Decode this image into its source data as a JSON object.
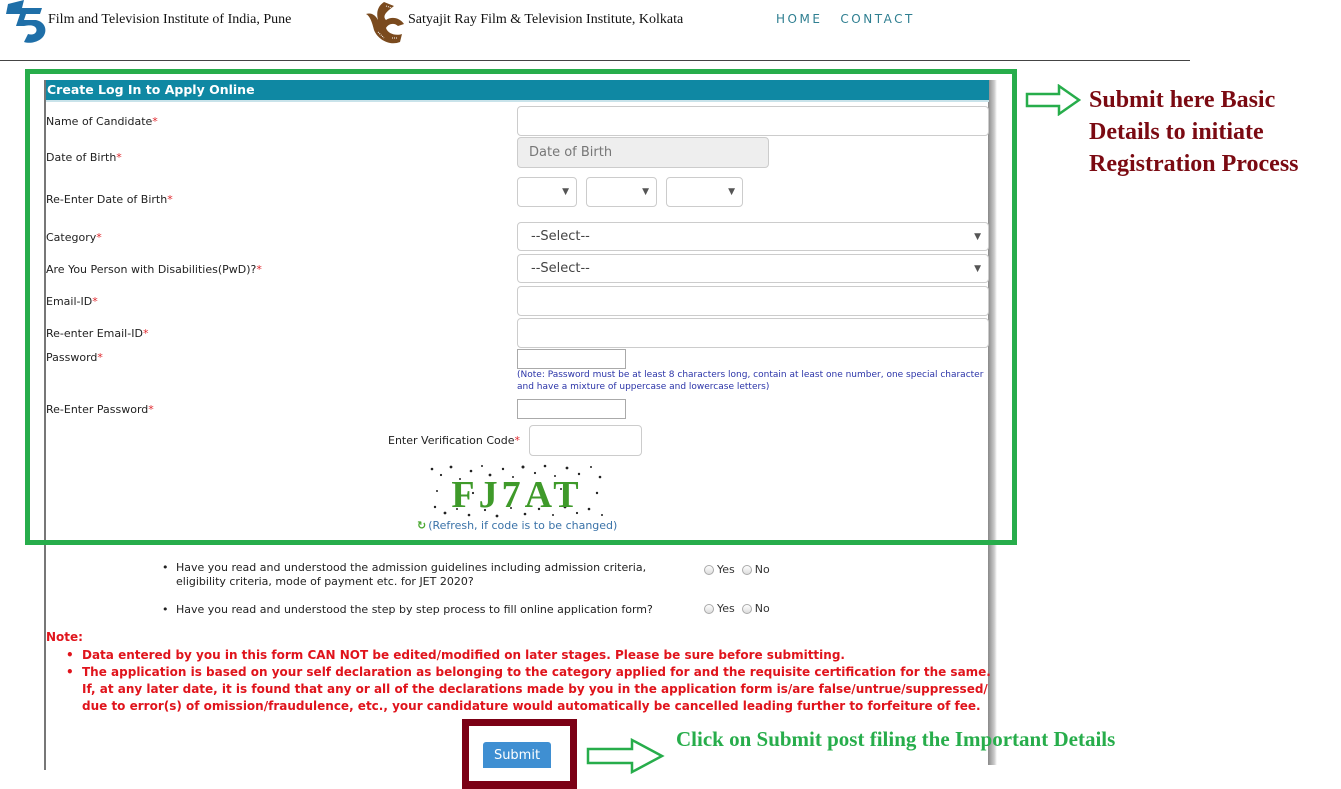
{
  "header": {
    "institute1": "Film and Television Institute of India, Pune",
    "institute2": "Satyajit Ray Film & Television Institute, Kolkata",
    "nav": [
      {
        "label": "HOME"
      },
      {
        "label": "CONTACT"
      }
    ]
  },
  "form": {
    "title": "Create Log In to Apply Online",
    "required_mark": "*",
    "fields": {
      "name": {
        "label": "Name of Candidate",
        "value": ""
      },
      "dob": {
        "label": "Date of Birth",
        "placeholder": "Date of Birth"
      },
      "dob_reenter": {
        "label": "Re-Enter Date of Birth",
        "day": "",
        "month": "",
        "year": ""
      },
      "category": {
        "label": "Category",
        "selected": "--Select--"
      },
      "pwd": {
        "label": "Are You Person with Disabilities(PwD)?",
        "selected": "--Select--"
      },
      "email": {
        "label": "Email-ID",
        "value": ""
      },
      "email_reenter": {
        "label": "Re-enter Email-ID",
        "value": ""
      },
      "password": {
        "label": "Password",
        "value": "",
        "note": "(Note: Password must be at least 8 characters long, contain at least one number, one special character and have a mixture of uppercase and lowercase letters)"
      },
      "password_reenter": {
        "label": "Re-Enter Password",
        "value": ""
      },
      "verification": {
        "label": "Enter Verification Code",
        "value": "",
        "captcha_text": "FJ7AT",
        "refresh_label": "(Refresh, if code is to be changed)"
      }
    },
    "questions": [
      {
        "text": "Have you read and understood the admission guidelines including admission criteria, eligibility criteria, mode of payment etc. for JET 2020?",
        "options": [
          "Yes",
          "No"
        ]
      },
      {
        "text": "Have you read and understood the step by step process to fill online application form?",
        "options": [
          "Yes",
          "No"
        ]
      }
    ],
    "note": {
      "title": "Note:",
      "items": [
        "Data entered by you in this form CAN NOT be edited/modified on later stages. Please be sure before submitting.",
        "The application is based on your self declaration as belonging to the category applied for and the requisite certification for the same. If, at any later date, it is found that any or all of the declarations made by you in the application form is/are false/untrue/suppressed/ due to error(s) of omission/fraudulence, etc., your candidature would automatically be cancelled leading further to forfeiture of fee."
      ]
    },
    "submit_label": "Submit"
  },
  "annotations": {
    "basic_details": "Submit here Basic Details to initiate Registration Process",
    "submit_hint": "Click on Submit post filing the Important Details",
    "colors": {
      "green": "#27ad4b",
      "maroon": "#7b0015",
      "header_teal": "#0f88a3"
    }
  }
}
